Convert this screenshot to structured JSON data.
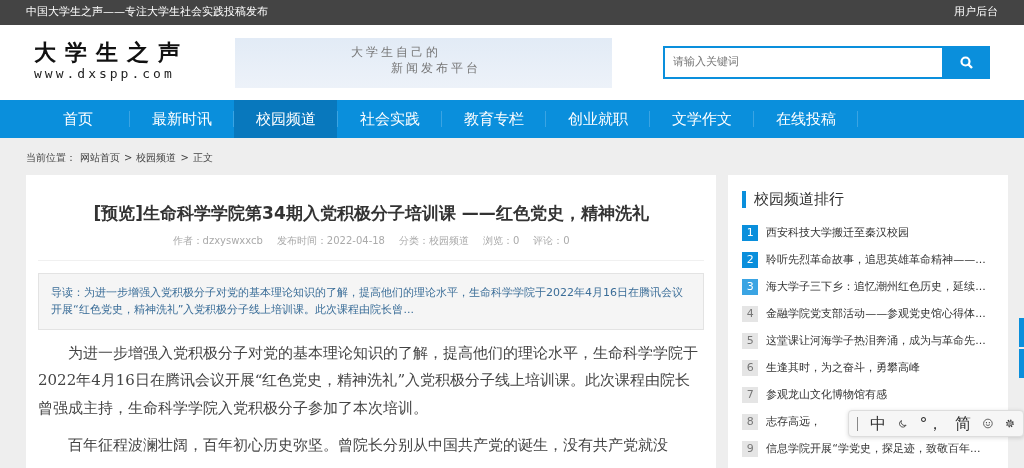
{
  "top_bar": {
    "slogan": "中国大学生之声——专注大学生社会实践投稿发布",
    "user_link": "用户后台"
  },
  "header": {
    "logo_title": "大学生之声",
    "logo_url": "www.dxspp.com",
    "banner_line_1": "大学生自己的",
    "banner_line_2": "新闻发布平台",
    "search": {
      "placeholder": "请输入关键词"
    }
  },
  "nav": [
    {
      "label": "首页",
      "selected": false
    },
    {
      "label": "最新时讯",
      "selected": false
    },
    {
      "label": "校园频道",
      "selected": true
    },
    {
      "label": "社会实践",
      "selected": false
    },
    {
      "label": "教育专栏",
      "selected": false
    },
    {
      "label": "创业就职",
      "selected": false
    },
    {
      "label": "文学作文",
      "selected": false
    },
    {
      "label": "在线投稿",
      "selected": false
    }
  ],
  "breadcrumb": {
    "prefix": "当前位置：",
    "items": [
      "网站首页",
      "校园频道",
      "正文"
    ],
    "separator": ">"
  },
  "article": {
    "title": "[预览]生命科学学院第34期入党积极分子培训课 ——红色党史，精神洗礼",
    "meta": [
      "作者：dzxyswxxcb",
      "发布时间：2022-04-18",
      "分类：校园频道",
      "浏览：0",
      "评论：0"
    ],
    "summary": "导读：为进一步增强入党积极分子对党的基本理论知识的了解，提高他们的理论水平，生命科学学院于2022年4月16日在腾讯会议开展“红色党史，精神洗礼”入党积极分子线上培训课。此次课程由院长曾...",
    "paragraphs": [
      "为进一步增强入党积极分子对党的基本理论知识的了解，提高他们的理论水平，生命科学学院于2022年4月16日在腾讯会议开展“红色党史，精神洗礼”入党积极分子线上培训课。此次课程由院长曾强成主持，生命科学学院入党积极分子参加了本次培训。",
      "百年征程波澜壮阔，百年初心历史弥坚。曾院长分别从中国共产党的诞生，没有共产党就没"
    ]
  },
  "sidebar": {
    "title": "校园频道排行",
    "items": [
      {
        "rank": "1",
        "title": "西安科技大学搬迁至秦汉校园",
        "top": true
      },
      {
        "rank": "2",
        "title": "聆听先烈革命故事，追思英雄革命精神——...",
        "top": true
      },
      {
        "rank": "3",
        "title": "海大学子三下乡：追忆潮州红色历史，延续...",
        "top": true
      },
      {
        "rank": "4",
        "title": "金融学院党支部活动——参观党史馆心得体...",
        "top": false
      },
      {
        "rank": "5",
        "title": "这堂课让河海学子热泪奔涌，成为与革命先...",
        "top": false
      },
      {
        "rank": "6",
        "title": "生逢其时，为之奋斗，勇攀高峰",
        "top": false
      },
      {
        "rank": "7",
        "title": "参观龙山文化博物馆有感",
        "top": false
      },
      {
        "rank": "8",
        "title": "志存高远，",
        "top": false
      },
      {
        "rank": "9",
        "title": "信息学院开展“学党史，探足迹，致敬百年...",
        "top": false
      }
    ]
  },
  "ime_toolbar": {
    "mode": "中",
    "punctuation": "°，",
    "script": "简"
  }
}
